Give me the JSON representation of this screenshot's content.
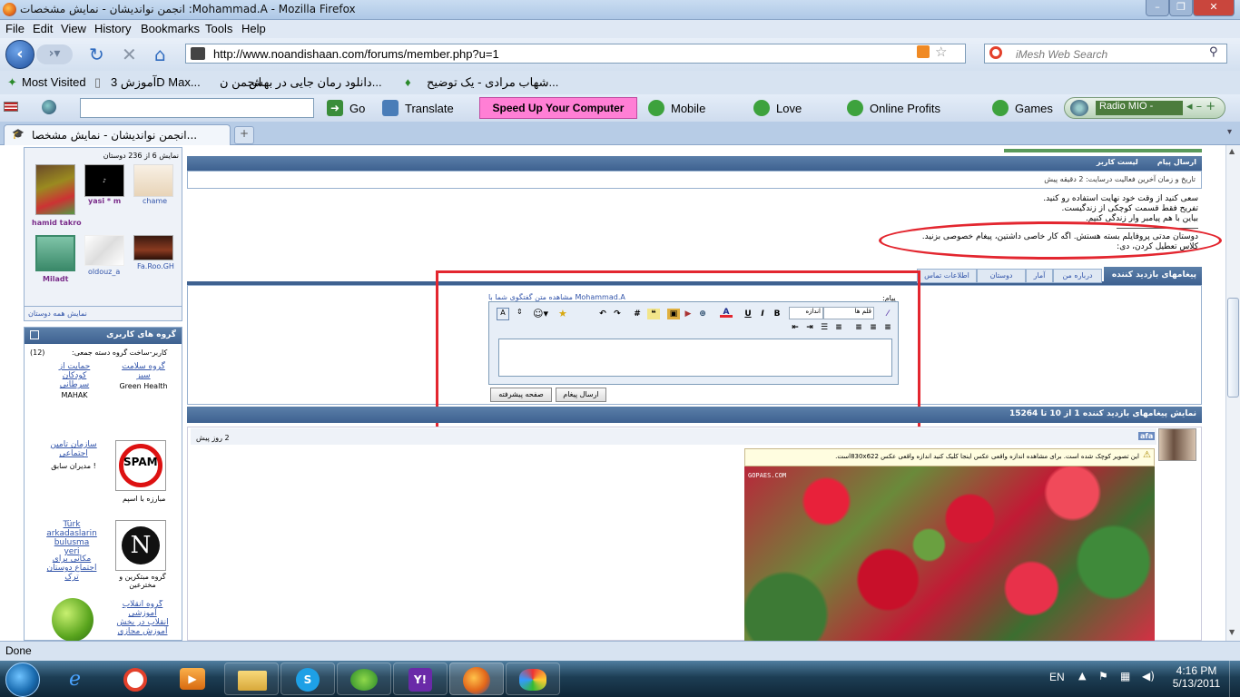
{
  "window": {
    "title": "انجمن نواندیشان - نمایش مشخصات :Mohammad.A - Mozilla Firefox"
  },
  "menu": [
    "File",
    "Edit",
    "View",
    "History",
    "Bookmarks",
    "Tools",
    "Help"
  ],
  "nav": {
    "url": "http://www.noandishaan.com/forums/member.php?u=1",
    "search_placeholder": "iMesh Web Search"
  },
  "bookmarks": [
    "Most Visited",
    "آموزش 3D Max...",
    "انجمن ن...",
    "دانلود رمان جایی در بهش...",
    "شهاب مرادی - یک توضیح..."
  ],
  "toolbar3": {
    "go": "Go",
    "translate": "Translate",
    "speed": "Speed Up Your Computer",
    "mobile": "Mobile",
    "love": "Love",
    "online_profits": "Online Profits",
    "games": "Games",
    "radio": "Radio MIO -"
  },
  "tab": {
    "label": "انجمن نواندیشان - نمایش مشخصا..."
  },
  "status": "Done",
  "clock": {
    "time": "4:16 PM",
    "date": "5/13/2011",
    "lang": "EN"
  },
  "page": {
    "friends_header": "نمایش 6 از 236 دوستان",
    "friends": [
      {
        "name": "hamid takro",
        "color": "#7a2c8a"
      },
      {
        "name": "yasi * m",
        "color": "#7a2c8a"
      },
      {
        "name": "chame",
        "color": "#3355aa"
      },
      {
        "name": "Miladt",
        "color": "#7a2c8a"
      },
      {
        "name": "oldouz_a",
        "color": "#3355aa"
      },
      {
        "name": "Fa.Roo.GH",
        "color": "#3355aa"
      }
    ],
    "all_friends": "نمایش همه دوستان",
    "groups_title": "گروه های کاربری",
    "groups_sub": "کاربر-ساخت گروه دسته جمعی:",
    "groups_count": "(12)",
    "groups": [
      {
        "a": "گروه سلامت سبز",
        "b": "Green Health"
      },
      {
        "a": "حمایت از کودکان سرطانی",
        "b": "MAHAK"
      },
      {
        "a": "مبارزه با اسپم",
        "b": ""
      },
      {
        "a": "سازمان تامین اجتماعی",
        "b": "مدیران سابق !"
      },
      {
        "a": "گروه مبتکرین و مخترعین",
        "b": ""
      },
      {
        "a": "Türk arkadaslarin bulusma yeri",
        "b": "مکانی برای اجتماع دوستان ترک"
      },
      {
        "a": "گروه انقلاب آموزشی",
        "b": "انقلاب در بخش آموزش مجازی"
      }
    ],
    "send_msg": "ارسال پیام",
    "user_list": "لیست کاربر",
    "last_activity": "تاریخ و زمان آخرین فعالیت درسایت: 2 دقیقه پیش",
    "bio": [
      "سعی کنید از وقت خود نهایت استفاده رو کنید.",
      "تفریح فقط قسمت کوچکی از زندگیست.",
      "بیاین با هم پیامبر وار زندگی کنیم."
    ],
    "note_line1": "دوستان مدتی پروفایلم بسته هستش. اگه کار خاصی داشتین، پیغام خصوصی بزنید.",
    "note_line2": "کلاس تعطیل کردن، دی:",
    "vm_title": "پیغامهای بازدید کننده",
    "tabs": [
      "درباره من",
      "آمار",
      "دوستان",
      "اطلاعات تماس"
    ],
    "msg_label": "پیام:",
    "convo_link": "مشاهده متن گفتگوی شما با Mohammad.A",
    "editor": {
      "font": "قلم ها",
      "size": "اندازه"
    },
    "btn_send": "ارسال پیغام",
    "btn_adv": "صفحه پیشرفته",
    "vm_range": "نمایش پیغامهای بازدید کننده 1 از 10 تا 15264",
    "post_user": "afa",
    "post_time": "2 روز پیش",
    "img_notice": "این تصویر کوچک شده است. برای مشاهده اندازه واقعی عکس اینجا کلیک کنید اندازه واقعی عکس 830x622است.",
    "watermark": "GOPAES.COM"
  },
  "colors": {
    "highlight": "#e3262f",
    "accent": "#3e6190"
  }
}
